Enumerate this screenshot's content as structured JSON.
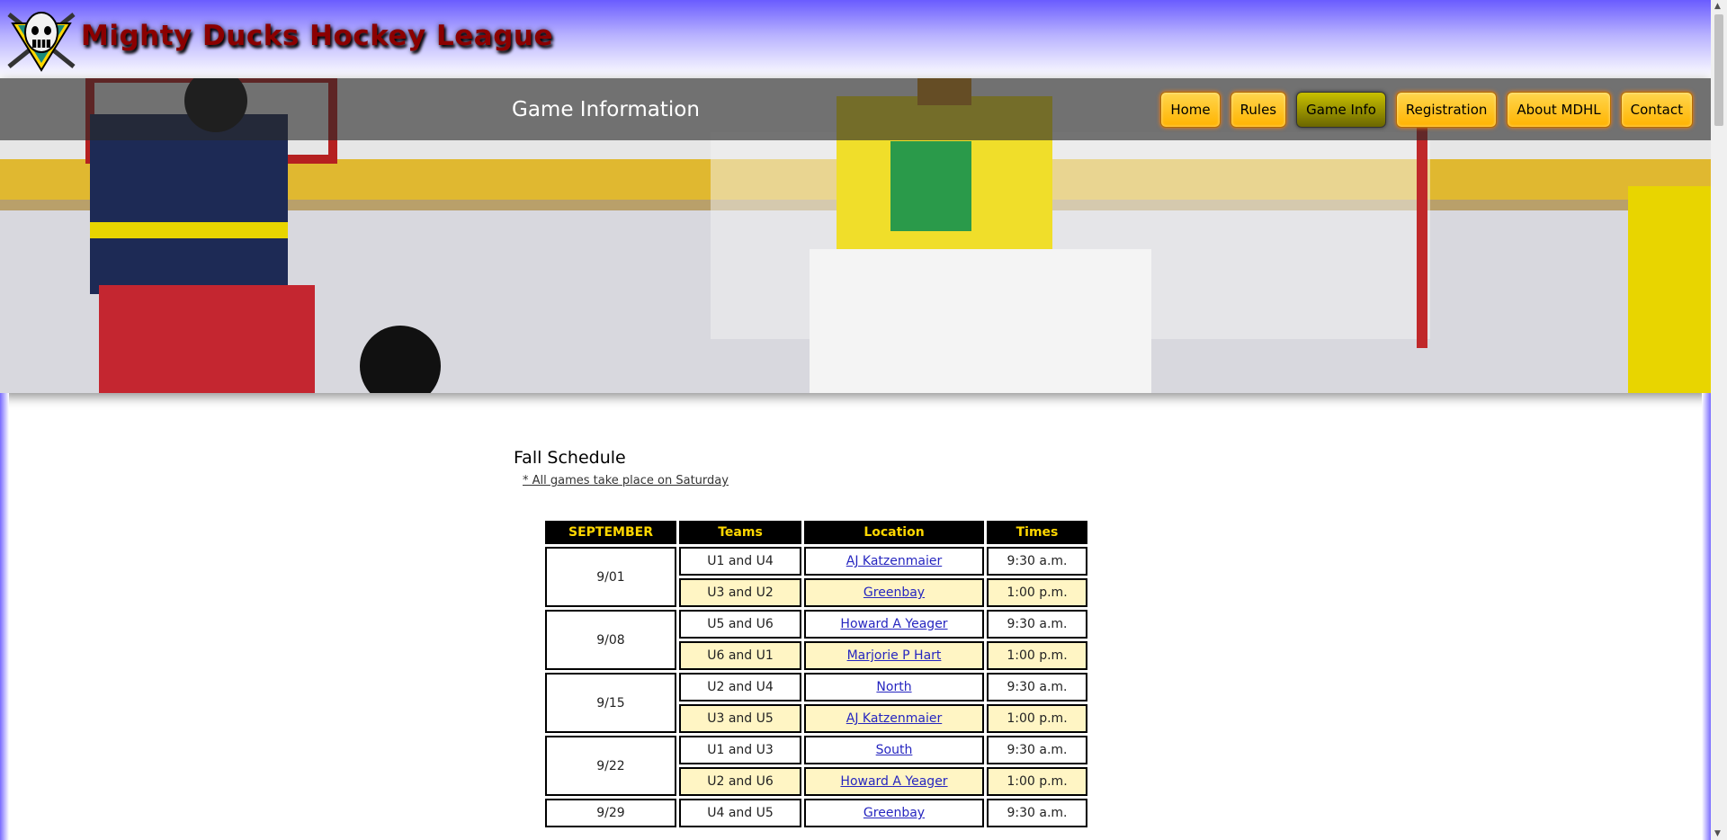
{
  "site": {
    "title": "Mighty Ducks Hockey League"
  },
  "page": {
    "heading": "Game Information"
  },
  "nav": {
    "items": [
      {
        "label": "Home",
        "active": false
      },
      {
        "label": "Rules",
        "active": false
      },
      {
        "label": "Game Info",
        "active": true
      },
      {
        "label": "Registration",
        "active": false
      },
      {
        "label": "About MDHL",
        "active": false
      },
      {
        "label": "Contact",
        "active": false
      }
    ]
  },
  "content": {
    "section_title": "Fall Schedule",
    "note": "* All games take place on Saturday"
  },
  "schedule": {
    "headers": [
      "SEPTEMBER",
      "Teams",
      "Location",
      "Times"
    ],
    "groups": [
      {
        "date": "9/01",
        "games": [
          {
            "teams": "U1 and U4",
            "location": "AJ Katzenmaier",
            "time": "9:30 a.m."
          },
          {
            "teams": "U3 and U2",
            "location": "Greenbay",
            "time": "1:00 p.m."
          }
        ]
      },
      {
        "date": "9/08",
        "games": [
          {
            "teams": "U5 and U6",
            "location": "Howard A Yeager",
            "time": "9:30 a.m."
          },
          {
            "teams": "U6 and U1",
            "location": "Marjorie P Hart",
            "time": "1:00 p.m."
          }
        ]
      },
      {
        "date": "9/15",
        "games": [
          {
            "teams": "U2 and U4",
            "location": "North",
            "time": "9:30 a.m."
          },
          {
            "teams": "U3 and U5",
            "location": "AJ Katzenmaier",
            "time": "1:00 p.m."
          }
        ]
      },
      {
        "date": "9/22",
        "games": [
          {
            "teams": "U1 and U3",
            "location": "South",
            "time": "9:30 a.m."
          },
          {
            "teams": "U2 and U6",
            "location": "Howard A Yeager",
            "time": "1:00 p.m."
          }
        ]
      },
      {
        "date": "9/29",
        "games": [
          {
            "teams": "U4 and U5",
            "location": "Greenbay",
            "time": "9:30 a.m."
          }
        ]
      }
    ]
  },
  "colors": {
    "header_gradient_top": "#6a5cff",
    "nav_button": "#ffc107",
    "nav_button_active": "#8a8500",
    "table_header_bg": "#000000",
    "table_header_text": "#ffd700",
    "alt_row": "#fff5c4",
    "link": "#2626c0",
    "title_text": "#8b0000"
  },
  "icons": {
    "logo": "hockey-mask-logo-icon"
  }
}
